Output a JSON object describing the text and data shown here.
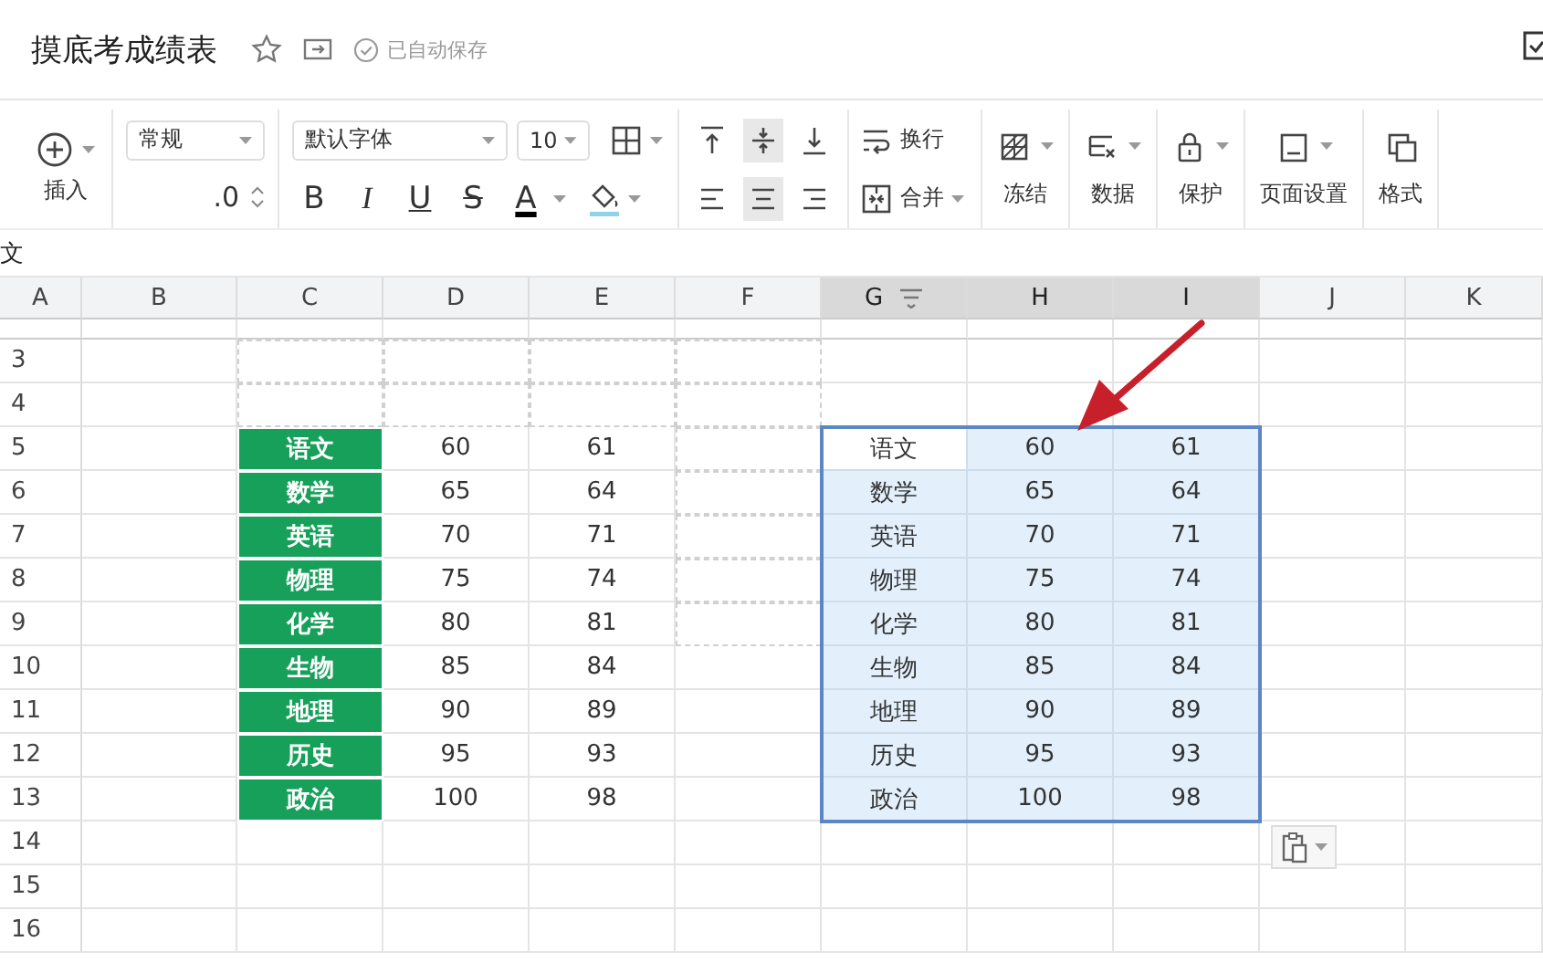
{
  "title_bar": {
    "title": "摸底考成绩表",
    "autosave": "已自动保存"
  },
  "toolbar": {
    "insert": "插入",
    "number_format": "常规",
    "decimal": ".0",
    "font": "默认字体",
    "font_size": "10",
    "format_buttons": [
      {
        "kind": "bold",
        "label": "B"
      },
      {
        "kind": "italic",
        "label": "I"
      },
      {
        "kind": "underline",
        "label": "U"
      },
      {
        "kind": "strike",
        "label": "S"
      },
      {
        "kind": "color",
        "label": "A"
      }
    ],
    "valign": [
      {
        "kind": "top",
        "selected": false
      },
      {
        "kind": "middle",
        "selected": true
      },
      {
        "kind": "bottom",
        "selected": false
      }
    ],
    "halign": [
      {
        "kind": "left",
        "selected": false
      },
      {
        "kind": "center",
        "selected": true
      },
      {
        "kind": "right",
        "selected": false
      }
    ],
    "wrap": "换行",
    "merge": "合并",
    "groups": [
      {
        "kind": "freeze",
        "label": "冻结"
      },
      {
        "kind": "data",
        "label": "数据"
      },
      {
        "kind": "protect",
        "label": "保护"
      },
      {
        "kind": "page",
        "label": "页面设置"
      },
      {
        "kind": "brush",
        "label": "格式"
      }
    ]
  },
  "formula_bar": {
    "value": "文"
  },
  "sheet": {
    "columns": [
      {
        "label": "A",
        "selected": false
      },
      {
        "label": "B",
        "selected": false
      },
      {
        "label": "C",
        "selected": false
      },
      {
        "label": "D",
        "selected": false
      },
      {
        "label": "E",
        "selected": false
      },
      {
        "label": "F",
        "selected": false
      },
      {
        "label": "G",
        "selected": true
      },
      {
        "label": "H",
        "selected": true
      },
      {
        "label": "I",
        "selected": true
      },
      {
        "label": "J",
        "selected": false
      },
      {
        "label": "K",
        "selected": false
      }
    ],
    "rows": [
      {
        "label": "3",
        "cells": {
          "C": {
            "dashed": true
          },
          "D": {
            "dashed": true
          },
          "E": {
            "dashed": true
          },
          "F": {
            "dashed": true
          }
        }
      },
      {
        "label": "4",
        "cells": {
          "C": {
            "dashed": true
          },
          "D": {
            "dashed": true
          },
          "E": {
            "dashed": true
          },
          "F": {
            "dashed": true
          }
        }
      },
      {
        "label": "5",
        "cells": {
          "C": {
            "text": "语文",
            "color": "#16a05a"
          },
          "D": {
            "text": "60"
          },
          "E": {
            "text": "61"
          },
          "F": {
            "dashed": true
          },
          "G": {
            "text": "语文",
            "selected": true,
            "active": true
          },
          "H": {
            "text": "60",
            "selected": true,
            "active": false
          },
          "I": {
            "text": "61",
            "selected": true,
            "active": false
          }
        }
      },
      {
        "label": "6",
        "cells": {
          "C": {
            "text": "数学",
            "color": "#16a05a"
          },
          "D": {
            "text": "65"
          },
          "E": {
            "text": "64"
          },
          "F": {
            "dashed": true
          },
          "G": {
            "text": "数学",
            "selected": true,
            "active": false
          },
          "H": {
            "text": "65",
            "selected": true,
            "active": false
          },
          "I": {
            "text": "64",
            "selected": true,
            "active": false
          }
        }
      },
      {
        "label": "7",
        "cells": {
          "C": {
            "text": "英语",
            "color": "#16a05a"
          },
          "D": {
            "text": "70"
          },
          "E": {
            "text": "71"
          },
          "F": {
            "dashed": true
          },
          "G": {
            "text": "英语",
            "selected": true,
            "active": false
          },
          "H": {
            "text": "70",
            "selected": true,
            "active": false
          },
          "I": {
            "text": "71",
            "selected": true,
            "active": false
          }
        }
      },
      {
        "label": "8",
        "cells": {
          "C": {
            "text": "物理",
            "color": "#16a05a"
          },
          "D": {
            "text": "75"
          },
          "E": {
            "text": "74"
          },
          "F": {
            "dashed": true
          },
          "G": {
            "text": "物理",
            "selected": true,
            "active": false
          },
          "H": {
            "text": "75",
            "selected": true,
            "active": false
          },
          "I": {
            "text": "74",
            "selected": true,
            "active": false
          }
        }
      },
      {
        "label": "9",
        "cells": {
          "C": {
            "text": "化学",
            "color": "#16a05a"
          },
          "D": {
            "text": "80"
          },
          "E": {
            "text": "81"
          },
          "F": {
            "dashed": true
          },
          "G": {
            "text": "化学",
            "selected": true,
            "active": false
          },
          "H": {
            "text": "80",
            "selected": true,
            "active": false
          },
          "I": {
            "text": "81",
            "selected": true,
            "active": false
          }
        }
      },
      {
        "label": "10",
        "cells": {
          "C": {
            "text": "生物",
            "color": "#16a05a"
          },
          "D": {
            "text": "85"
          },
          "E": {
            "text": "84"
          },
          "G": {
            "text": "生物",
            "selected": true,
            "active": false
          },
          "H": {
            "text": "85",
            "selected": true,
            "active": false
          },
          "I": {
            "text": "84",
            "selected": true,
            "active": false
          }
        }
      },
      {
        "label": "11",
        "cells": {
          "C": {
            "text": "地理",
            "color": "#16a05a"
          },
          "D": {
            "text": "90"
          },
          "E": {
            "text": "89"
          },
          "G": {
            "text": "地理",
            "selected": true,
            "active": false
          },
          "H": {
            "text": "90",
            "selected": true,
            "active": false
          },
          "I": {
            "text": "89",
            "selected": true,
            "active": false
          }
        }
      },
      {
        "label": "12",
        "cells": {
          "C": {
            "text": "历史",
            "color": "#16a05a"
          },
          "D": {
            "text": "95"
          },
          "E": {
            "text": "93"
          },
          "G": {
            "text": "历史",
            "selected": true,
            "active": false
          },
          "H": {
            "text": "95",
            "selected": true,
            "active": false
          },
          "I": {
            "text": "93",
            "selected": true,
            "active": false
          }
        }
      },
      {
        "label": "13",
        "cells": {
          "C": {
            "text": "政治",
            "color": "#16a05a"
          },
          "D": {
            "text": "100"
          },
          "E": {
            "text": "98"
          },
          "G": {
            "text": "政治",
            "selected": true,
            "active": false
          },
          "H": {
            "text": "100",
            "selected": true,
            "active": false
          },
          "I": {
            "text": "98",
            "selected": true,
            "active": false
          }
        }
      },
      {
        "label": "14",
        "cells": {}
      },
      {
        "label": "15",
        "cells": {}
      },
      {
        "label": "16",
        "cells": {}
      }
    ]
  }
}
